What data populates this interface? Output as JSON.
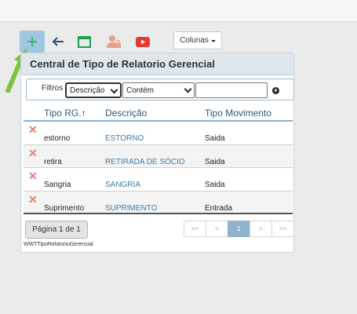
{
  "toolbar": {
    "add_icon": "plus-icon",
    "back_icon": "arrow-left-icon",
    "window_icon": "window-icon",
    "user_lock_icon": "user-lock-icon",
    "youtube_icon": "youtube-icon",
    "columns_label": "Colunas",
    "colors": {
      "add_bg": "#9fc7df",
      "add_plus": "#3cb371",
      "window": "#16a34a",
      "user": "#e7a08c",
      "youtube": "#e53935"
    }
  },
  "panel": {
    "title": "Central de Tipo de Relatorio Gerencial"
  },
  "filter": {
    "label": "Filtros",
    "field_value": "Descrição",
    "operator_value": "Contém",
    "input_value": ""
  },
  "grid": {
    "columns": [
      "Tipo RG.",
      "Descrição",
      "Tipo Movimento"
    ],
    "sort_indicator": "↑",
    "rows": [
      {
        "tipo": "estorno",
        "descricao": "ESTORNO",
        "movimento": "Saida"
      },
      {
        "tipo": "retira",
        "descricao": "RETIRADA DE SÓCIO",
        "movimento": "Saida"
      },
      {
        "tipo": "Sangria",
        "descricao": "SANGRIA",
        "movimento": "Saida"
      },
      {
        "tipo": "Suprimento",
        "descricao": "SUPRIMENTO",
        "movimento": "Entrada"
      }
    ]
  },
  "pager": {
    "page_info": "Página 1 de 1",
    "first": "<<",
    "prev": "<",
    "current": "1",
    "next": ">",
    "last": ">>"
  },
  "footer": {
    "object_name": "WWTTipoRelatorioGerencial"
  }
}
